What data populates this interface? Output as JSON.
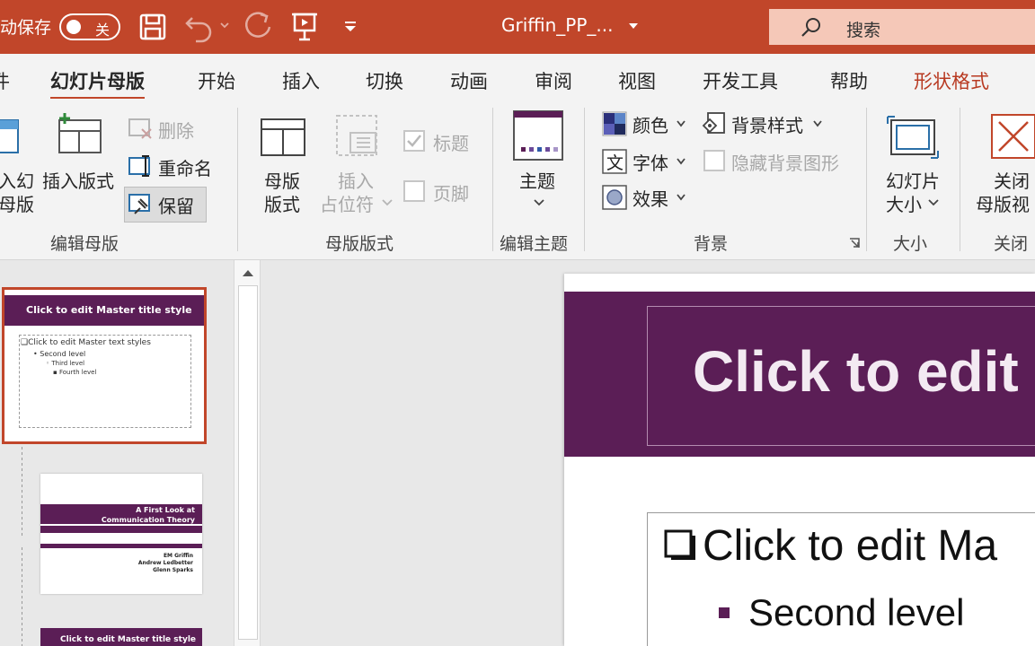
{
  "colors": {
    "accent": "#c1462a",
    "slide_theme": "#5b1e56",
    "search_bg": "#f5c8b8"
  },
  "titlebar": {
    "autosave_label": "动保存",
    "autosave_state": "关",
    "doc_title": "Griffin_PP_...",
    "search_placeholder": "搜索",
    "icons": [
      "save-icon",
      "undo-icon",
      "redo-icon",
      "present-icon",
      "customize-qat-icon",
      "search-icon"
    ]
  },
  "tabs": [
    {
      "label": "件"
    },
    {
      "label": "幻灯片母版"
    },
    {
      "label": "开始"
    },
    {
      "label": "插入"
    },
    {
      "label": "切换"
    },
    {
      "label": "动画"
    },
    {
      "label": "审阅"
    },
    {
      "label": "视图"
    },
    {
      "label": "开发工具"
    },
    {
      "label": "帮助"
    },
    {
      "label": "形状格式"
    }
  ],
  "ribbon": {
    "edit_master": {
      "label": "编辑母版",
      "insert_slide_master": [
        "入幻",
        "母版"
      ],
      "insert_layout": "插入版式",
      "delete": "删除",
      "rename": "重命名",
      "preserve": "保留"
    },
    "master_layout": {
      "label": "母版版式",
      "master_layout_btn": [
        "母版",
        "版式"
      ],
      "insert_placeholder": [
        "插入",
        "占位符"
      ],
      "title_check": "标题",
      "footer_check": "页脚"
    },
    "edit_theme": {
      "label": "编辑主题",
      "themes": "主题"
    },
    "background": {
      "label": "背景",
      "colors": "颜色",
      "fonts": "字体",
      "effects": "效果",
      "background_styles": "背景样式",
      "hide_bg_graphics": "隐藏背景图形"
    },
    "size": {
      "label": "大小",
      "slide_size": [
        "幻灯片",
        "大小"
      ]
    },
    "close": {
      "label": "关闭",
      "close_master_view": [
        "关闭",
        "母版视"
      ]
    }
  },
  "thumbnails": {
    "t1": {
      "title": "Click to edit Master title style",
      "lines": [
        "❑Click to edit Master text styles",
        "• Second level",
        "◦ Third level",
        "▪ Fourth level"
      ]
    },
    "t2": {
      "lines": [
        "A First Look at",
        "Communication Theory",
        "EM Griffin",
        "Andrew Ledbetter",
        "Glenn Sparks"
      ]
    },
    "t3": {
      "title": "Click to edit Master title style"
    }
  },
  "slide": {
    "title": "Click to edit",
    "level1": "Click to edit Ma",
    "level2": "Second level"
  }
}
